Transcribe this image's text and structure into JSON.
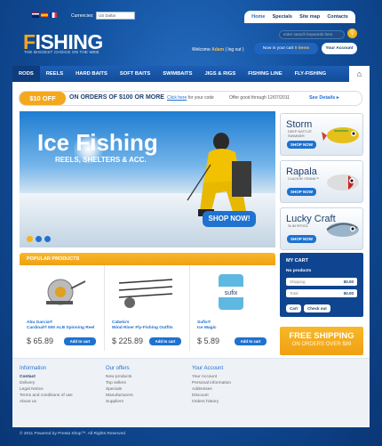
{
  "header": {
    "currencies_label": "Currencies:",
    "currency_value": "US Dollar",
    "topnav": [
      {
        "label": "Home"
      },
      {
        "label": "Specials"
      },
      {
        "label": "Site map"
      },
      {
        "label": "Contacts"
      }
    ],
    "logo_first": "F",
    "logo_rest": "ISHING",
    "tagline": "THE BIGGEST CHOICE ON THE WEB",
    "search_placeholder": "enter search keywords here",
    "search_icon": "magnifier-icon",
    "welcome": "Welcome",
    "user": "Adam",
    "logout": "( log out )",
    "cart_text": "Now in your cart",
    "cart_count": "0 items",
    "account": "Your Account"
  },
  "menu": [
    {
      "label": "RODS"
    },
    {
      "label": "REELS"
    },
    {
      "label": "HARD BAITS"
    },
    {
      "label": "SOFT BAITS"
    },
    {
      "label": "SWIMBAITS"
    },
    {
      "label": "JIGS & RIGS"
    },
    {
      "label": "FISHING LINE"
    },
    {
      "label": "FLY-FISHING"
    }
  ],
  "menu_home_icon": "home-icon",
  "promo": {
    "pct": "$10 OFF",
    "text": "ON ORDERS OF $100 OR MORE",
    "click": "Click here",
    "for_code": "for your code",
    "good": "Offer good through 12/07/2011",
    "see": "See Details"
  },
  "banner": {
    "title": "Ice Fishing",
    "subtitle": "REELS, SHELTERS & ACC.",
    "shop": "SHOP NOW!"
  },
  "lures": [
    {
      "title": "Storm",
      "sub1": "DEEP NATTUIT",
      "sub2": "SWIMMER",
      "btn": "SHOP NOW"
    },
    {
      "title": "Rapala",
      "sub1": "CLACKIN' CRANK™",
      "sub2": "",
      "btn": "SHOP NOW"
    },
    {
      "title": "Lucky Craft",
      "sub1": "SLIM SPOOL",
      "sub2": "",
      "btn": "SHOP NOW"
    }
  ],
  "popular": {
    "title": "POPULAR PRODUCTS",
    "products": [
      {
        "name1": "Abu Garcia®",
        "name2": "Cardinal® 500 ALB Spinning Reel",
        "price": "$ 65.89",
        "add": "Add to cart"
      },
      {
        "name1": "Cabela's",
        "name2": "Wind River Fly-Fishing Outfits",
        "price": "$ 225.89",
        "add": "Add to cart"
      },
      {
        "name1": "Sufix®",
        "name2": "Ice Magic",
        "price": "$ 5.89",
        "add": "Add to cart"
      }
    ]
  },
  "cart": {
    "title": "MY CART",
    "no_products": "No products",
    "shipping": "Shipping",
    "shipping_val": "$0.00",
    "total": "Total",
    "total_val": "$0.00",
    "cart_btn": "Cart",
    "checkout_btn": "Check out"
  },
  "free": {
    "line1": "FREE SHIPPING",
    "line2": "ON ORDERS OVER $99"
  },
  "footer": {
    "cols": [
      {
        "title": "Information",
        "items": [
          "Contact",
          "Delivery",
          "Legal Notice",
          "Terms and conditions of use",
          "About us"
        ]
      },
      {
        "title": "Our offers",
        "items": [
          "New products",
          "Top sellers",
          "Specials",
          "Manufacturers",
          "Suppliers"
        ]
      },
      {
        "title": "Your Account",
        "items": [
          "Your Account",
          "Personal information",
          "Addresses",
          "Discount",
          "Orders history"
        ]
      }
    ],
    "copyright": "© 2011 Powered by Presta Shop™. All Rights Reserved"
  }
}
